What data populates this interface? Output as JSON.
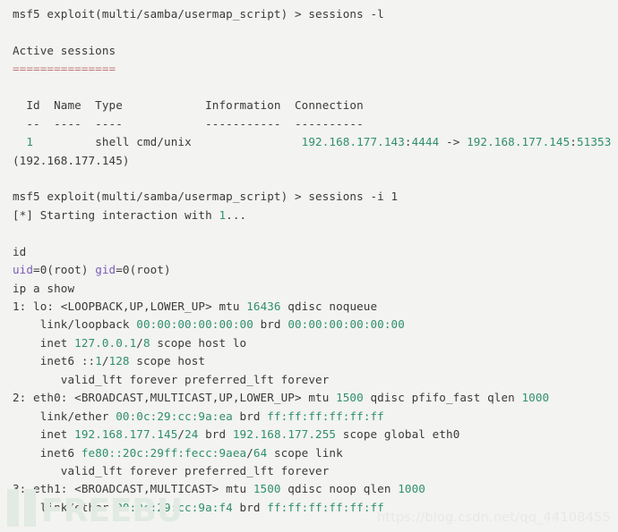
{
  "terminal": {
    "background_color": "#f3f3f1",
    "default_text_color": "#3a3a38",
    "accent_colors": {
      "teal": "#2f8f6f",
      "purple": "#7b5cb8",
      "red": "#c07a78"
    },
    "lines": [
      {
        "id": "prompt-sessions-list",
        "segments": [
          {
            "text": "msf5 exploit(multi/samba/usermap_script) > sessions -l",
            "color": "default"
          }
        ]
      },
      {
        "id": "blank-1",
        "segments": [
          {
            "text": " ",
            "color": "default"
          }
        ]
      },
      {
        "id": "active-sessions-heading",
        "segments": [
          {
            "text": "Active sessions",
            "color": "default"
          }
        ]
      },
      {
        "id": "active-sessions-rule",
        "segments": [
          {
            "text": "===============",
            "color": "red"
          }
        ]
      },
      {
        "id": "blank-2",
        "segments": [
          {
            "text": " ",
            "color": "default"
          }
        ]
      },
      {
        "id": "sessions-table-header",
        "segments": [
          {
            "text": "  Id  Name  Type            Information  Connection",
            "color": "default"
          }
        ]
      },
      {
        "id": "sessions-table-rule",
        "segments": [
          {
            "text": "  --  ----  ----            -----------  ----------",
            "color": "default"
          }
        ]
      },
      {
        "id": "sessions-row-1",
        "segments": [
          {
            "text": "  ",
            "color": "default"
          },
          {
            "text": "1",
            "color": "teal"
          },
          {
            "text": "         shell cmd/unix                ",
            "color": "default"
          },
          {
            "text": "192.168.177.143",
            "color": "teal"
          },
          {
            "text": ":",
            "color": "default"
          },
          {
            "text": "4444",
            "color": "teal"
          },
          {
            "text": " -> ",
            "color": "default"
          },
          {
            "text": "192.168.177.145",
            "color": "teal"
          },
          {
            "text": ":",
            "color": "default"
          },
          {
            "text": "51353",
            "color": "teal"
          }
        ]
      },
      {
        "id": "sessions-row-1-wrap",
        "segments": [
          {
            "text": "(192.168.177.145)",
            "color": "default"
          }
        ]
      },
      {
        "id": "blank-3",
        "segments": [
          {
            "text": " ",
            "color": "default"
          }
        ]
      },
      {
        "id": "prompt-sessions-interact",
        "segments": [
          {
            "text": "msf5 exploit(multi/samba/usermap_script) > sessions -i 1",
            "color": "default"
          }
        ]
      },
      {
        "id": "starting-interaction",
        "segments": [
          {
            "text": "[*] Starting interaction with ",
            "color": "default"
          },
          {
            "text": "1",
            "color": "teal"
          },
          {
            "text": "...",
            "color": "default"
          }
        ]
      },
      {
        "id": "blank-4",
        "segments": [
          {
            "text": " ",
            "color": "default"
          }
        ]
      },
      {
        "id": "cmd-id",
        "segments": [
          {
            "text": "id",
            "color": "default"
          }
        ]
      },
      {
        "id": "out-id",
        "segments": [
          {
            "text": "uid",
            "color": "purple"
          },
          {
            "text": "=0(root) ",
            "color": "default"
          },
          {
            "text": "gid",
            "color": "purple"
          },
          {
            "text": "=0(root)",
            "color": "default"
          }
        ]
      },
      {
        "id": "cmd-ip-a-show",
        "segments": [
          {
            "text": "ip a show",
            "color": "default"
          }
        ]
      },
      {
        "id": "iface-lo",
        "segments": [
          {
            "text": "1: lo: <LOOPBACK,UP,LOWER_UP> mtu ",
            "color": "default"
          },
          {
            "text": "16436",
            "color": "teal"
          },
          {
            "text": " qdisc noqueue",
            "color": "default"
          }
        ]
      },
      {
        "id": "lo-link-loopback",
        "segments": [
          {
            "text": "    link/loopback ",
            "color": "default"
          },
          {
            "text": "00:00:00:00:00:00",
            "color": "teal"
          },
          {
            "text": " brd ",
            "color": "default"
          },
          {
            "text": "00:00:00:00:00:00",
            "color": "teal"
          }
        ]
      },
      {
        "id": "lo-inet",
        "segments": [
          {
            "text": "    inet ",
            "color": "default"
          },
          {
            "text": "127.0.0.1",
            "color": "teal"
          },
          {
            "text": "/",
            "color": "default"
          },
          {
            "text": "8",
            "color": "teal"
          },
          {
            "text": " scope host lo",
            "color": "default"
          }
        ]
      },
      {
        "id": "lo-inet6",
        "segments": [
          {
            "text": "    inet6 ::",
            "color": "default"
          },
          {
            "text": "1",
            "color": "teal"
          },
          {
            "text": "/",
            "color": "default"
          },
          {
            "text": "128",
            "color": "teal"
          },
          {
            "text": " scope host",
            "color": "default"
          }
        ]
      },
      {
        "id": "lo-lft",
        "segments": [
          {
            "text": "       valid_lft forever preferred_lft forever",
            "color": "default"
          }
        ]
      },
      {
        "id": "iface-eth0",
        "segments": [
          {
            "text": "2: eth0: <BROADCAST,MULTICAST,UP,LOWER_UP> mtu ",
            "color": "default"
          },
          {
            "text": "1500",
            "color": "teal"
          },
          {
            "text": " qdisc pfifo_fast qlen ",
            "color": "default"
          },
          {
            "text": "1000",
            "color": "teal"
          }
        ]
      },
      {
        "id": "eth0-link-ether",
        "segments": [
          {
            "text": "    link/ether ",
            "color": "default"
          },
          {
            "text": "00:0c:29:cc:9a:ea",
            "color": "teal"
          },
          {
            "text": " brd ",
            "color": "default"
          },
          {
            "text": "ff:ff:ff:ff:ff:ff",
            "color": "teal"
          }
        ]
      },
      {
        "id": "eth0-inet",
        "segments": [
          {
            "text": "    inet ",
            "color": "default"
          },
          {
            "text": "192.168.177.145",
            "color": "teal"
          },
          {
            "text": "/",
            "color": "default"
          },
          {
            "text": "24",
            "color": "teal"
          },
          {
            "text": " brd ",
            "color": "default"
          },
          {
            "text": "192.168.177.255",
            "color": "teal"
          },
          {
            "text": " scope global eth0",
            "color": "default"
          }
        ]
      },
      {
        "id": "eth0-inet6",
        "segments": [
          {
            "text": "    inet6 ",
            "color": "default"
          },
          {
            "text": "fe80::20c:29ff:fecc:9aea",
            "color": "teal"
          },
          {
            "text": "/",
            "color": "default"
          },
          {
            "text": "64",
            "color": "teal"
          },
          {
            "text": " scope link",
            "color": "default"
          }
        ]
      },
      {
        "id": "eth0-lft",
        "segments": [
          {
            "text": "       valid_lft forever preferred_lft forever",
            "color": "default"
          }
        ]
      },
      {
        "id": "iface-eth1",
        "segments": [
          {
            "text": "3: eth1: <BROADCAST,MULTICAST> mtu ",
            "color": "default"
          },
          {
            "text": "1500",
            "color": "teal"
          },
          {
            "text": " qdisc noop qlen ",
            "color": "default"
          },
          {
            "text": "1000",
            "color": "teal"
          }
        ]
      },
      {
        "id": "eth1-link-ether",
        "segments": [
          {
            "text": "    link/ether ",
            "color": "default"
          },
          {
            "text": "00:0c:29:cc:9a:f4",
            "color": "teal"
          },
          {
            "text": " brd ",
            "color": "default"
          },
          {
            "text": "ff:ff:ff:ff:ff:ff",
            "color": "teal"
          }
        ]
      }
    ]
  },
  "watermarks": {
    "freebuf_text": "FREEBUF",
    "freebuf_color": "#e2ebe4",
    "csdn_url": "https://blog.csdn.net/qq_44108455",
    "csdn_color": "#e8e8e6"
  }
}
